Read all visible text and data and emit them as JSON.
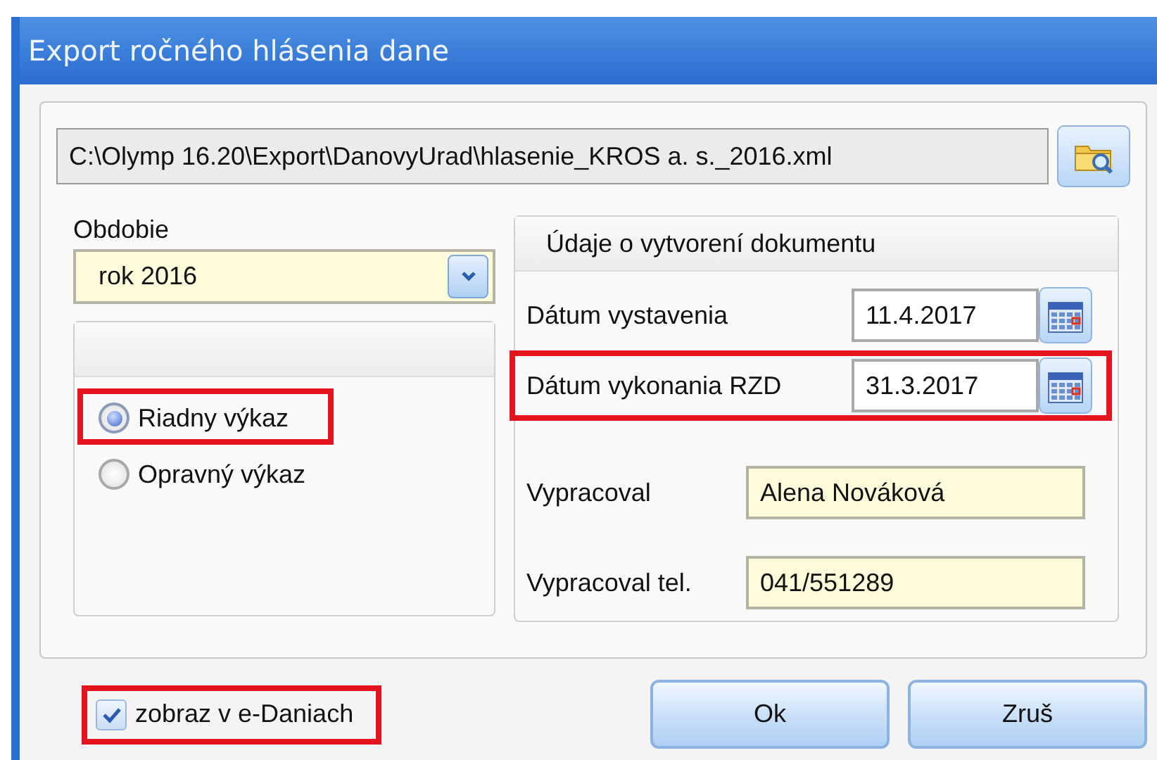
{
  "window": {
    "title": "Export ročného hlásenia dane"
  },
  "file_path": {
    "value": "C:\\Olymp 16.20\\Export\\DanovyUrad\\hlasenie_KROS a. s._2016.xml"
  },
  "period": {
    "label": "Obdobie",
    "value": "rok 2016"
  },
  "report_type": [
    {
      "label": "Riadny výkaz",
      "selected": true,
      "highlighted": true
    },
    {
      "label": "Opravný výkaz",
      "selected": false,
      "highlighted": false
    }
  ],
  "document_info": {
    "title": "Údaje o vytvorení dokumentu",
    "fields": [
      {
        "kind": "date",
        "label": "Dátum vystavenia",
        "value": "11.4.2017",
        "highlighted": false
      },
      {
        "kind": "date",
        "label": "Dátum vykonania RZD",
        "value": "31.3.2017",
        "highlighted": true
      },
      {
        "kind": "text",
        "label": "Vypracoval",
        "value": "Alena Nováková",
        "highlighted": false
      },
      {
        "kind": "text",
        "label": "Vypracoval tel.",
        "value": "041/551289",
        "highlighted": false
      }
    ]
  },
  "show_in_edane": {
    "label": "zobraz v e-Daniach",
    "checked": true,
    "highlighted": true
  },
  "buttons": [
    "Ok",
    "Zruš"
  ]
}
